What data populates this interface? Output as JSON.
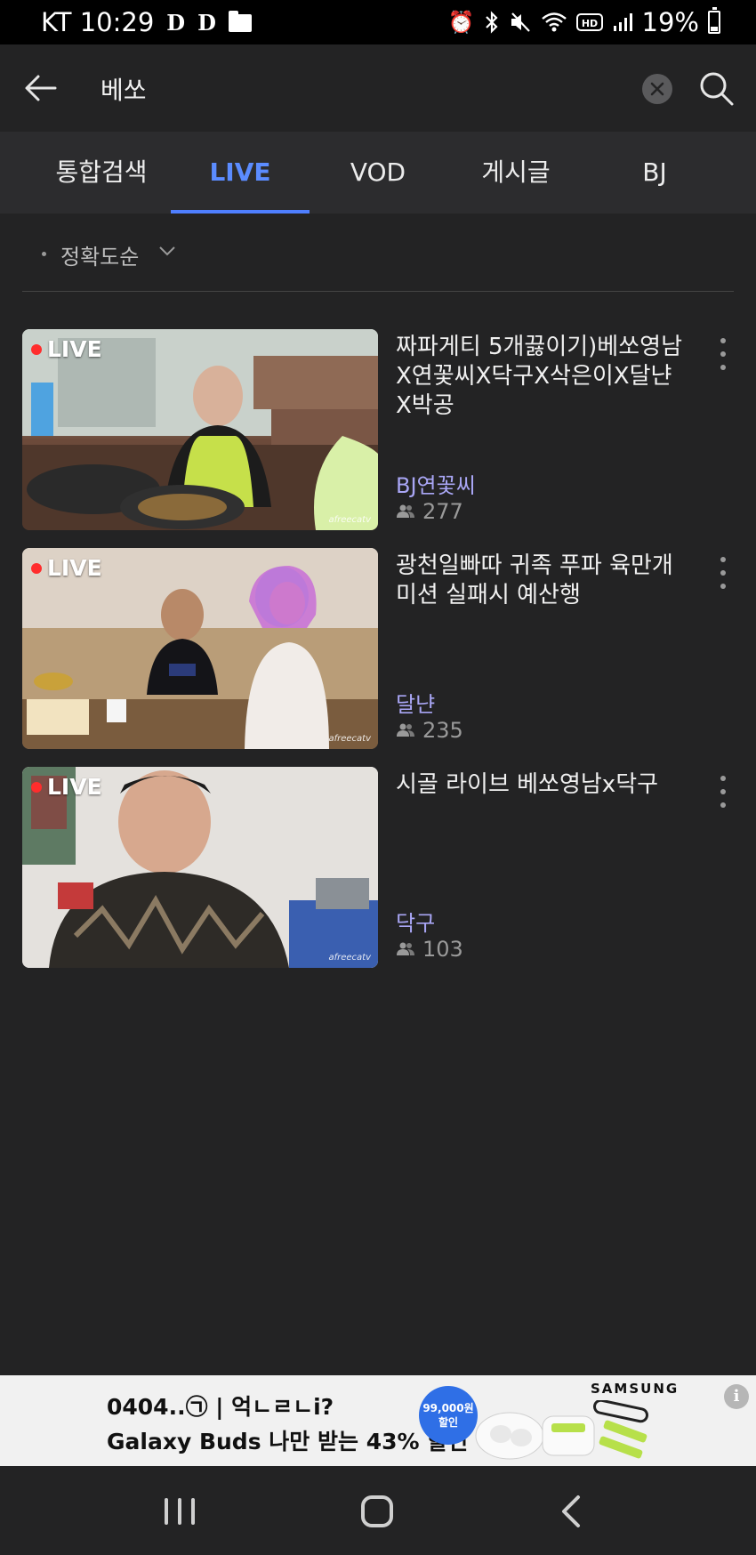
{
  "status_bar": {
    "carrier_time": "KT 10:29",
    "notif_d1": "D",
    "notif_d2": "D",
    "battery": "19%",
    "icons": [
      "alarm-icon",
      "bluetooth-icon",
      "mute-icon",
      "wifi-icon",
      "hd-icon",
      "signal-icon",
      "battery-icon"
    ]
  },
  "search": {
    "query": "베쏘"
  },
  "tabs": [
    {
      "label": "통합검색",
      "active": false
    },
    {
      "label": "LIVE",
      "active": true
    },
    {
      "label": "VOD",
      "active": false
    },
    {
      "label": "게시글",
      "active": false
    },
    {
      "label": "BJ",
      "active": false
    }
  ],
  "sort": {
    "label": "정확도순"
  },
  "results": [
    {
      "badge": "LIVE",
      "title": "짜파게티 5개끓이기)베쏘영남X연꽃씨X닥구X삭은이X달냔X박공",
      "bj": "BJ연꽃씨",
      "viewers": "277",
      "watermark": "afreecatv"
    },
    {
      "badge": "LIVE",
      "title": "광천일빠따 귀족 푸파 육만개미션 실패시 예산행",
      "bj": "달냔",
      "viewers": "235",
      "watermark": "afreecatv"
    },
    {
      "badge": "LIVE",
      "title": "시골 라이브 베쏘영남x닥구",
      "bj": "닥구",
      "viewers": "103",
      "watermark": "afreecatv"
    }
  ],
  "ad": {
    "line1": "0404..㉠ | 억ㄴㄹㄴi?",
    "line2": "Galaxy Buds 나만 받는 43% 할인",
    "badge_line1": "99,000원",
    "badge_line2": "할인",
    "brand": "SAMSUNG",
    "info": "i"
  },
  "colors": {
    "background": "#232324",
    "tab_bar": "#2c2c2e",
    "accent": "#5b8cff",
    "bj_name": "#a9a6f5",
    "live_dot": "#ff2d2d"
  }
}
